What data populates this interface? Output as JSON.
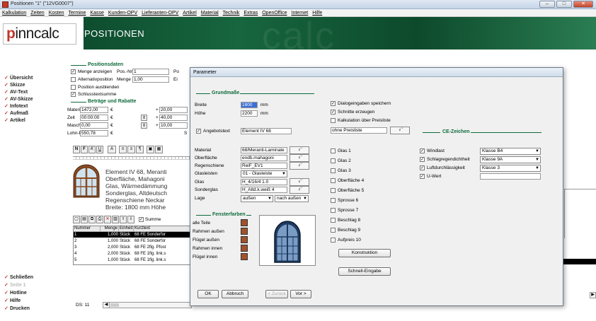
{
  "window": {
    "title": "Positionen \"1\" (\"12VG0007\")",
    "min": "–",
    "max": "□",
    "close": "✕"
  },
  "menu": [
    "Kalkulation",
    "Zeiten",
    "Kosten",
    "Termine",
    "Kasse",
    "Kunden-OPV",
    "Lieferanten-OPV",
    "Artikel",
    "Material",
    "Technik",
    "Extras",
    "OpenOffice",
    "Internet",
    "Hilfe"
  ],
  "header": {
    "logo_prefix": "p",
    "logo_rest": "inncalc",
    "title": "POSITIONEN",
    "watermark": "calc"
  },
  "sidebar": {
    "top": [
      {
        "label": "Übersicht",
        "mark": "✓"
      },
      {
        "label": "Skizze",
        "mark": "✓"
      },
      {
        "label": "AV-Text",
        "mark": "✓"
      },
      {
        "label": "AV-Skizze",
        "mark": "✓"
      },
      {
        "label": "Infotext",
        "mark": "✓"
      },
      {
        "label": "Aufmaß",
        "mark": "✓"
      },
      {
        "label": "Artikel",
        "mark": "✓"
      }
    ],
    "bottom": [
      {
        "label": "Schließen",
        "mark": "✓"
      },
      {
        "label": "Seite 1",
        "mark": "✓"
      },
      {
        "label": "Hotline",
        "mark": "✓"
      },
      {
        "label": "Hilfe",
        "mark": "✓"
      },
      {
        "label": "Drucken",
        "mark": "✓"
      }
    ]
  },
  "main": {
    "positionsdaten": "Positionsdaten",
    "menge_anzeigen": "Menge anzeigen",
    "pos_nr_label": "Pos.-Nr.",
    "pos_nr_value": "1",
    "po_label": "Po",
    "alternativ": "Alternativposition",
    "menge_label": "Menge",
    "menge_value": "1,00",
    "ei_label": "Ei",
    "position_ausblenden": "Position ausblenden",
    "schlusstext": "Schlusstextsumme",
    "betraege": "Beträge und Rabatte",
    "material_label": "Material",
    "material_value": "1472,00",
    "zeit_label": "Zeit",
    "zeit_value": "00:00:00",
    "maschine_label": "Maschine",
    "maschine_value": "0,00",
    "lohn_label": "Lohn-EK",
    "lohn_value": "550,78",
    "euro": "€",
    "rabatt_1": "20,00",
    "rabatt_2": "40,00",
    "rabatt_3": "10,00",
    "plus": "+",
    "s_label": "S",
    "text_lines": [
      "Element IV 68, Meranti",
      "Oberfläche, Mahagoni",
      "Glas, Wärmedämmung",
      "Sonderglas, Altdeutsch",
      "Regenschiene Neckar",
      "Breite: 1800 mm Höhe"
    ],
    "toolbar_text": [
      "N",
      "F",
      "K",
      "U"
    ],
    "summe_label": "Summe",
    "table_headers": [
      "Nummer",
      "Menge",
      "Einheit",
      "Kurztext"
    ],
    "rows": [
      {
        "nr": "1",
        "menge": "1,000",
        "einheit": "Stück",
        "text": "68 FE Sonderfor"
      },
      {
        "nr": "2",
        "menge": "1,000",
        "einheit": "Stück",
        "text": "68 FE Sonderfor"
      },
      {
        "nr": "3",
        "menge": "2,000",
        "einheit": "Stück",
        "text": "68 FE 2flg. Pfost"
      },
      {
        "nr": "4",
        "menge": "2,000",
        "einheit": "Stück",
        "text": "68 FE 1flg. link.s"
      },
      {
        "nr": "5",
        "menge": "1,000",
        "einheit": "Stück",
        "text": "68 FE 1flg. link.s"
      }
    ],
    "ds_label": "DS: 11"
  },
  "dialog": {
    "title": "Parameter",
    "grundmasse": "Grundmaße",
    "breite_label": "Breite",
    "breite_value": "1800",
    "hoehe_label": "Höhe",
    "hoehe_value": "2200",
    "mm": "mm",
    "angebotstext_label": "Angebotstext",
    "angebotstext_value": "Element IV 68",
    "material_label": "Material",
    "material_value": "68/Meranti-Laminate",
    "oberflaeche_label": "Oberfläche",
    "oberflaeche_value": "endb.mahagoni",
    "regenschiene_label": "Regenschiene",
    "regenschiene_value": "ReiF_EV1",
    "glasleisten_label": "Glasleisten",
    "glasleisten_value": "01 - Glasleiste",
    "glas_label": "Glas",
    "glas_value": "H_4/16/4 1.0",
    "sonderglas_label": "Sonderglas",
    "sonderglas_value": "H_Altd.k.weiß 4",
    "lage_label": "Lage",
    "lage_value1": "außen",
    "lage_value2": "nach außen",
    "icon_glyph": "♀̈",
    "fensterfarben": "Fensterfarben",
    "farben": [
      "alle Teile",
      "Rahmen außen",
      "Flügel außen",
      "Rahmen innen",
      "Flügel innen"
    ],
    "dialogeingaben": "Dialogeingaben speichern",
    "schnitte": "Schnitte erzeugen",
    "kalkulation_preisliste": "Kalkulation über Preisliste",
    "preisliste_value": "ohne Preisliste",
    "checkboxes_mid": [
      "Glas 1",
      "Glas 2",
      "Glas 3",
      "Oberfläche 4",
      "Oberfläche 5",
      "Sprosse 6",
      "Sprosse 7",
      "Beschlag 8",
      "Beschlag 9",
      "Aufpreis 10"
    ],
    "ce_zeichen": "CE-Zeichen",
    "ce_items": [
      {
        "label": "Windlast",
        "value": "Klasse B4"
      },
      {
        "label": "Schlagregendichtheit",
        "value": "Klasse 9A"
      },
      {
        "label": "Luftdurchlässigkeit",
        "value": "Klasse 3"
      },
      {
        "label": "U-Wert",
        "value": ""
      }
    ],
    "konstruktion": "Konstruktion",
    "schnell_eingabe": "Schnell-Eingabe",
    "ok": "OK",
    "abbruch": "Abbruch",
    "zurueck": "< Zurück",
    "vor": "Vor >"
  }
}
